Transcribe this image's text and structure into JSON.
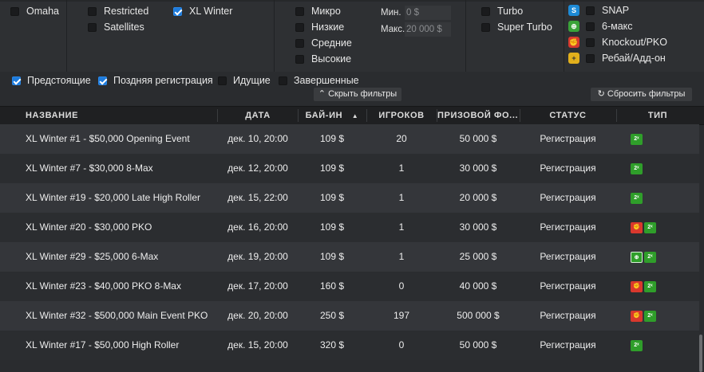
{
  "filters": {
    "col1": [
      {
        "label": "Omaha",
        "checked": false
      }
    ],
    "col2": [
      {
        "label": "Restricted",
        "checked": false
      },
      {
        "label": "Satellites",
        "checked": false
      }
    ],
    "col3": [
      {
        "label": "XL Winter",
        "checked": true
      }
    ],
    "limits": [
      {
        "label": "Микро",
        "checked": false
      },
      {
        "label": "Низкие",
        "checked": false
      },
      {
        "label": "Средние",
        "checked": false
      },
      {
        "label": "Высокие",
        "checked": false
      }
    ],
    "min_label": "Мин.",
    "min_value": "0 $",
    "max_label": "Макс.",
    "max_value": "20 000 $",
    "speed": [
      {
        "label": "Turbo",
        "checked": false
      },
      {
        "label": "Super Turbo",
        "checked": false
      }
    ],
    "types": [
      {
        "label": "SNAP",
        "checked": false,
        "icon": "snap-icon",
        "color": "#1d8ad6"
      },
      {
        "label": "6-макс",
        "checked": false,
        "icon": "six-max-icon",
        "color": "#3aa339"
      },
      {
        "label": "Knockout/PKO",
        "checked": false,
        "icon": "knockout-icon",
        "color": "#d7392f"
      },
      {
        "label": "Ребай/Адд-он",
        "checked": false,
        "icon": "rebuy-icon",
        "color": "#e2b01c"
      }
    ]
  },
  "status_filters": [
    {
      "label": "Предстоящие",
      "checked": true
    },
    {
      "label": "Поздняя регистрация",
      "checked": true
    },
    {
      "label": "Идущие",
      "checked": false
    },
    {
      "label": "Завершенные",
      "checked": false
    }
  ],
  "hide_filters_label": "Скрыть фильтры",
  "reset_filters_label": "Сбросить фильтры",
  "columns": {
    "name": "НАЗВАНИЕ",
    "date": "ДАТА",
    "buyin": "БАЙ-ИН",
    "players": "ИГРОКОВ",
    "prize": "ПРИЗОВОЙ ФО...",
    "status": "СТАТУС",
    "type": "ТИП"
  },
  "sort_indicator": "▲",
  "tournaments": [
    {
      "name": "XL Winter #1 - $50,000 Opening Event",
      "date": "дек. 10, 20:00",
      "buyin": "109 $",
      "players": "20",
      "prize": "50 000 $",
      "status": "Регистрация",
      "badges": [
        "2x"
      ]
    },
    {
      "name": "XL Winter #7 - $30,000 8-Max",
      "date": "дек. 12, 20:00",
      "buyin": "109 $",
      "players": "1",
      "prize": "30 000 $",
      "status": "Регистрация",
      "badges": [
        "2x"
      ]
    },
    {
      "name": "XL Winter #19 - $20,000 Late High Roller",
      "date": "дек. 15, 22:00",
      "buyin": "109 $",
      "players": "1",
      "prize": "20 000 $",
      "status": "Регистрация",
      "badges": [
        "2x"
      ]
    },
    {
      "name": "XL Winter #20 - $30,000 PKO",
      "date": "дек. 16, 20:00",
      "buyin": "109 $",
      "players": "1",
      "prize": "30 000 $",
      "status": "Регистрация",
      "badges": [
        "ko",
        "2x"
      ]
    },
    {
      "name": "XL Winter #29 - $25,000 6-Max",
      "date": "дек. 19, 20:00",
      "buyin": "109 $",
      "players": "1",
      "prize": "25 000 $",
      "status": "Регистрация",
      "badges": [
        "6max",
        "2x"
      ]
    },
    {
      "name": "XL Winter #23 - $40,000 PKO 8-Max",
      "date": "дек. 17, 20:00",
      "buyin": "160 $",
      "players": "0",
      "prize": "40 000 $",
      "status": "Регистрация",
      "badges": [
        "ko",
        "2x"
      ]
    },
    {
      "name": "XL Winter #32 - $500,000 Main Event PKO",
      "date": "дек. 20, 20:00",
      "buyin": "250 $",
      "players": "197",
      "prize": "500 000 $",
      "status": "Регистрация",
      "badges": [
        "ko",
        "2x"
      ]
    },
    {
      "name": "XL Winter #17 - $50,000 High Roller",
      "date": "дек. 15, 20:00",
      "buyin": "320 $",
      "players": "0",
      "prize": "50 000 $",
      "status": "Регистрация",
      "badges": [
        "2x"
      ]
    }
  ]
}
